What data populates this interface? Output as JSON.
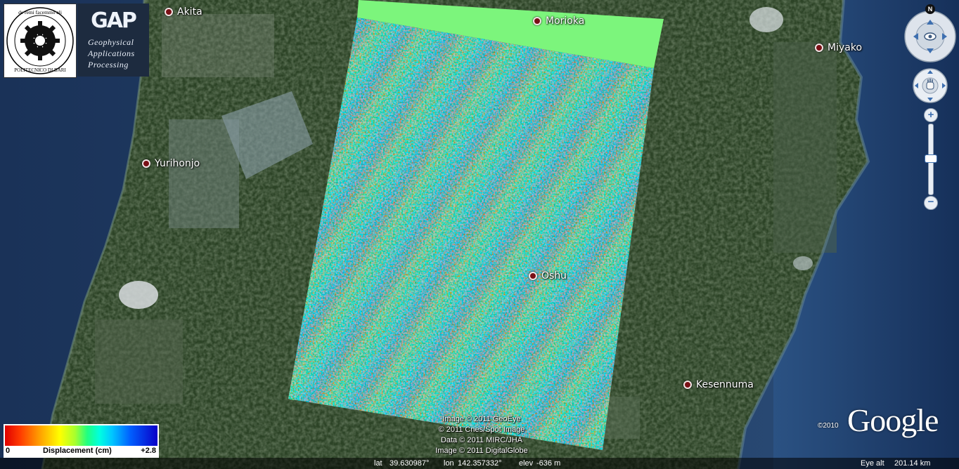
{
  "cities": [
    {
      "id": "akita",
      "name": "Akita"
    },
    {
      "id": "morioka",
      "name": "Morioka"
    },
    {
      "id": "miyako",
      "name": "Miyako"
    },
    {
      "id": "yurihonjo",
      "name": "Yurihonjo"
    },
    {
      "id": "oshu",
      "name": "Oshu"
    },
    {
      "id": "kesennuma",
      "name": "Kesennuma"
    }
  ],
  "logos": {
    "poliba": {
      "arc_text": "de remi facemmo ali",
      "bottom_text": "POLITECNICO DI BARI"
    },
    "gap": {
      "mark": "GAP",
      "line1": "Geophysical",
      "line2": "Applications",
      "line3": "Processing"
    }
  },
  "legend": {
    "min_label": "0",
    "title": "Displacement (cm)",
    "max_label": "+2.8"
  },
  "credits": {
    "line1": "Image © 2011 GeoEye",
    "line2": "© 2011 Cnes/Spot Image",
    "line3": "Data © 2011 MIRC/JHA",
    "line4": "Image © 2011 DigitalGlobe"
  },
  "status": {
    "lat_label": "lat",
    "lat": "39.630987°",
    "lon_label": "lon",
    "lon": "142.357332°",
    "elev_label": "elev",
    "elev": "-636 m",
    "eye_label": "Eye alt",
    "eye": "201.14 km"
  },
  "brand": {
    "copyright": "©2010",
    "logo": "Google"
  },
  "controls": {
    "north_label": "N",
    "zoom_in": "+",
    "zoom_out": "−"
  },
  "colors": {
    "ocean": "#1d3d66",
    "land": "#2c4326",
    "frame_fill": "#7cf57c"
  }
}
